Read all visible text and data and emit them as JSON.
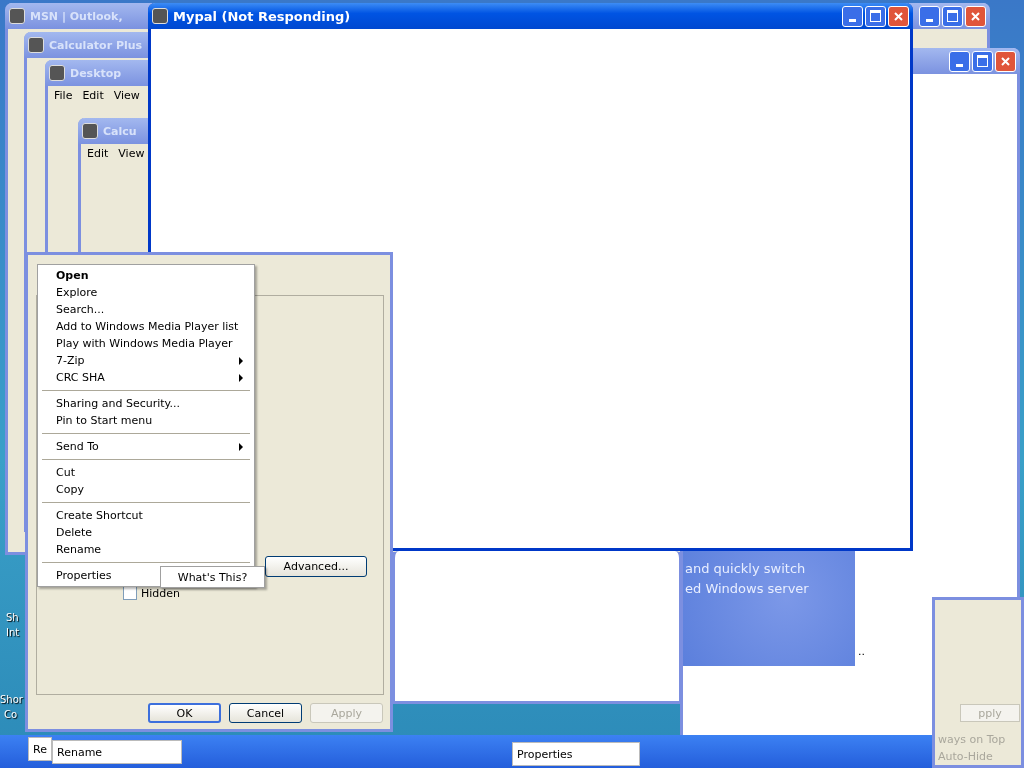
{
  "desktop_icons": [
    {
      "label": "Sh"
    },
    {
      "label": "Int"
    },
    {
      "label": "Shor"
    },
    {
      "label": "Co"
    }
  ],
  "windows": [
    {
      "kind": "plain",
      "title": "MSN | Outlook,",
      "active": false
    },
    {
      "kind": "plain",
      "title": "Calculator Plus",
      "active": false
    },
    {
      "kind": "menu",
      "title": "Desktop",
      "active": false,
      "menu": [
        "File",
        "Edit",
        "View"
      ]
    },
    {
      "kind": "menu",
      "title": "Calcu",
      "active": false,
      "menu": [
        "Edit",
        "View"
      ]
    },
    {
      "kind": "plain",
      "title": "Mypal (Not Responding)",
      "active": true
    }
  ],
  "splash": {
    "lines": [
      "and quickly switch",
      "ed Windows server"
    ],
    "note": ".."
  },
  "properties_dialog": {
    "advanced_button": "Advanced...",
    "hidden_checkbox": {
      "label": "Hidden",
      "checked": false
    },
    "buttons": [
      {
        "label": "OK",
        "disabled": false
      },
      {
        "label": "Cancel",
        "disabled": false
      },
      {
        "label": "Apply",
        "disabled": true
      }
    ]
  },
  "context_menu": [
    {
      "kind": "item",
      "label": "Open",
      "bold": true,
      "submenu": false
    },
    {
      "kind": "item",
      "label": "Explore",
      "bold": false,
      "submenu": false
    },
    {
      "kind": "item",
      "label": "Search...",
      "bold": false,
      "submenu": false
    },
    {
      "kind": "item",
      "label": "Add to Windows Media Player list",
      "bold": false,
      "submenu": false
    },
    {
      "kind": "item",
      "label": "Play with Windows Media Player",
      "bold": false,
      "submenu": false
    },
    {
      "kind": "item",
      "label": "7-Zip",
      "bold": false,
      "submenu": true
    },
    {
      "kind": "item",
      "label": "CRC SHA",
      "bold": false,
      "submenu": true
    },
    {
      "kind": "separator"
    },
    {
      "kind": "item",
      "label": "Sharing and Security...",
      "bold": false,
      "submenu": false
    },
    {
      "kind": "item",
      "label": "Pin to Start menu",
      "bold": false,
      "submenu": false
    },
    {
      "kind": "separator"
    },
    {
      "kind": "item",
      "label": "Send To",
      "bold": false,
      "submenu": true
    },
    {
      "kind": "separator"
    },
    {
      "kind": "item",
      "label": "Cut",
      "bold": false,
      "submenu": false
    },
    {
      "kind": "item",
      "label": "Copy",
      "bold": false,
      "submenu": false
    },
    {
      "kind": "separator"
    },
    {
      "kind": "item",
      "label": "Create Shortcut",
      "bold": false,
      "submenu": false
    },
    {
      "kind": "item",
      "label": "Delete",
      "bold": false,
      "submenu": false
    },
    {
      "kind": "item",
      "label": "Rename",
      "bold": false,
      "submenu": false
    },
    {
      "kind": "separator"
    },
    {
      "kind": "item",
      "label": "Properties",
      "bold": false,
      "submenu": false
    }
  ],
  "tooltip": "What's This?",
  "taskbar_fragments": [
    "Re",
    "Rename",
    "Properties"
  ],
  "right_fragments": {
    "apply": "pply",
    "always_on_top": "ways on Top",
    "auto_hide": "Auto-Hide"
  }
}
